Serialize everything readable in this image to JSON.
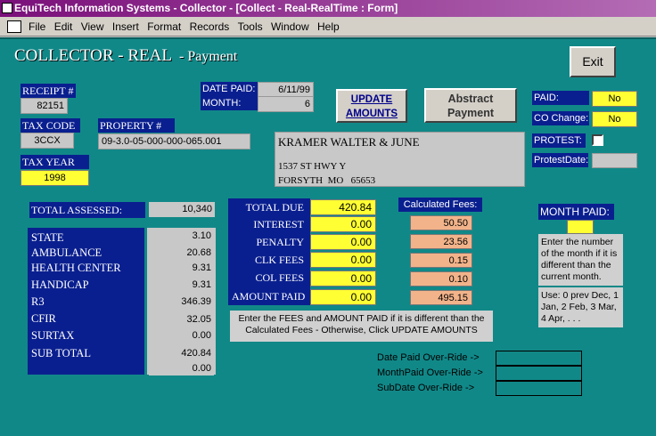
{
  "window": {
    "title": "EquiTech Information Systems - Collector - [Collect - Real-RealTime : Form]"
  },
  "menu": [
    "File",
    "Edit",
    "View",
    "Insert",
    "Format",
    "Records",
    "Tools",
    "Window",
    "Help"
  ],
  "header": {
    "title": "COLLECTOR - REAL",
    "subtitle": "- Payment",
    "exit": "Exit"
  },
  "receipt": {
    "label": "RECEIPT #",
    "value": "82151"
  },
  "tax_code": {
    "label": "TAX CODE",
    "value": "3CCX"
  },
  "property": {
    "label": "PROPERTY #",
    "value": "09-3.0-05-000-000-065.001"
  },
  "tax_year": {
    "label": "TAX YEAR",
    "value": "1998"
  },
  "date_paid": {
    "label": "DATE PAID:",
    "value": "6/11/99"
  },
  "month": {
    "label": "MONTH:",
    "value": "6"
  },
  "buttons": {
    "update": "UPDATE AMOUNTS",
    "abstract": "Abstract Payment"
  },
  "owner": {
    "name": "KRAMER WALTER & JUNE",
    "addr1": "1537 ST HWY Y",
    "city": "FORSYTH",
    "state": "MO",
    "zip": "65653"
  },
  "flags": {
    "paid_label": "PAID:",
    "paid_value": "No",
    "co_label": "CO Change:",
    "co_value": "No",
    "protest_label": "PROTEST:",
    "protest_date_label": "ProtestDate:"
  },
  "assessed": {
    "label": "TOTAL ASSESSED:",
    "value": "10,340"
  },
  "levies": [
    {
      "label": "STATE",
      "value": "3.10"
    },
    {
      "label": "AMBULANCE",
      "value": "20.68"
    },
    {
      "label": "HEALTH CENTER",
      "value": "9.31"
    },
    {
      "label": "HANDICAP",
      "value": "9.31"
    },
    {
      "label": "R3",
      "value": "346.39"
    },
    {
      "label": "CFIR",
      "value": "32.05"
    },
    {
      "label": "SURTAX",
      "value": "0.00"
    },
    {
      "label": "SUB TOTAL",
      "value": "420.84"
    },
    {
      "label": "",
      "value": "0.00"
    }
  ],
  "amounts": [
    {
      "label": "TOTAL DUE",
      "value": "420.84"
    },
    {
      "label": "INTEREST",
      "value": "0.00"
    },
    {
      "label": "PENALTY",
      "value": "0.00"
    },
    {
      "label": "CLK FEES",
      "value": "0.00"
    },
    {
      "label": "COL FEES",
      "value": "0.00"
    },
    {
      "label": "AMOUNT PAID",
      "value": "0.00"
    }
  ],
  "calc": {
    "label": "Calculated Fees:",
    "values": [
      "50.50",
      "23.56",
      "0.15",
      "0.10",
      "495.15"
    ]
  },
  "instructions": "Enter the FEES and AMOUNT PAID if it is different than the Calculated Fees - Otherwise, Click UPDATE AMOUNTS",
  "month_paid": {
    "label": "MONTH PAID:",
    "note1": "Enter the number of the month if it is different than the current month.",
    "note2": "Use: 0 prev Dec, 1 Jan, 2 Feb, 3 Mar, 4 Apr, . . ."
  },
  "overrides": [
    "Date Paid Over-Ride ->",
    "MonthPaid Over-Ride ->",
    "SubDate Over-Ride ->"
  ]
}
